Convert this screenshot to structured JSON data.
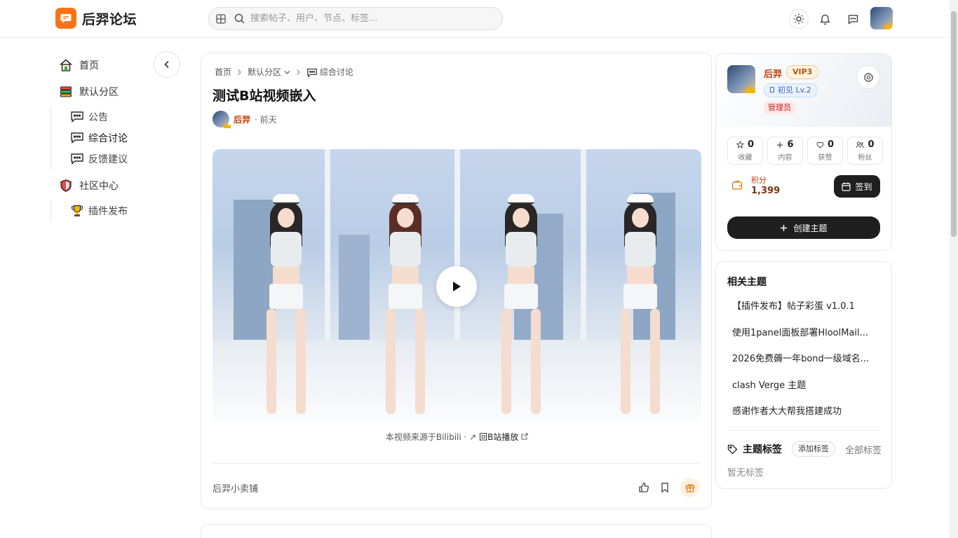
{
  "header": {
    "site_name": "后羿论坛",
    "search_placeholder": "搜索帖子、用户、节点、标签..."
  },
  "sidebar": {
    "items": [
      {
        "label": "首页",
        "icon": "home-icon"
      },
      {
        "label": "默认分区",
        "icon": "books-icon"
      },
      {
        "label": "社区中心",
        "icon": "shield-icon"
      }
    ],
    "default_sub": [
      {
        "label": "公告"
      },
      {
        "label": "综合讨论"
      },
      {
        "label": "反馈建议"
      }
    ],
    "community_sub": [
      {
        "label": "插件发布"
      }
    ]
  },
  "post": {
    "breadcrumb": [
      "首页",
      "默认分区",
      "综合讨论"
    ],
    "title": "测试B站视频嵌入",
    "author": "后羿",
    "time": "· 前天",
    "video_source": "本视频来源于Bilibili ·",
    "video_link": "回B站播放",
    "shop_label": "后羿小卖铺"
  },
  "user_card": {
    "name": "后羿",
    "vip": "VIP3",
    "level": "初见 Lv.2",
    "role": "管理员",
    "stats": [
      {
        "value": "0",
        "label": "收藏",
        "icon": "star-icon"
      },
      {
        "value": "6",
        "label": "内容",
        "icon": "plus-icon"
      },
      {
        "value": "0",
        "label": "获赞",
        "icon": "heart-icon"
      },
      {
        "value": "0",
        "label": "粉丝",
        "icon": "users-icon"
      }
    ],
    "points_label": "积分",
    "points_value": "1,399",
    "checkin_label": "签到",
    "create_label": "创建主题"
  },
  "related": {
    "title": "相关主题",
    "items": [
      "【插件发布】帖子彩蛋 v1.0.1",
      "使用1panel面板部署HloolMail...",
      "2026免费薅一年bond一级域名...",
      "clash Verge 主题",
      "感谢作者大大帮我搭建成功"
    ],
    "tags_title": "主题标签",
    "add_tag": "添加标签",
    "all_tags": "全部标签",
    "no_tags": "暂无标签"
  },
  "colors": {
    "brand": "#f97316",
    "author": "#c2410c",
    "dark_button": "#1f1f1f"
  }
}
